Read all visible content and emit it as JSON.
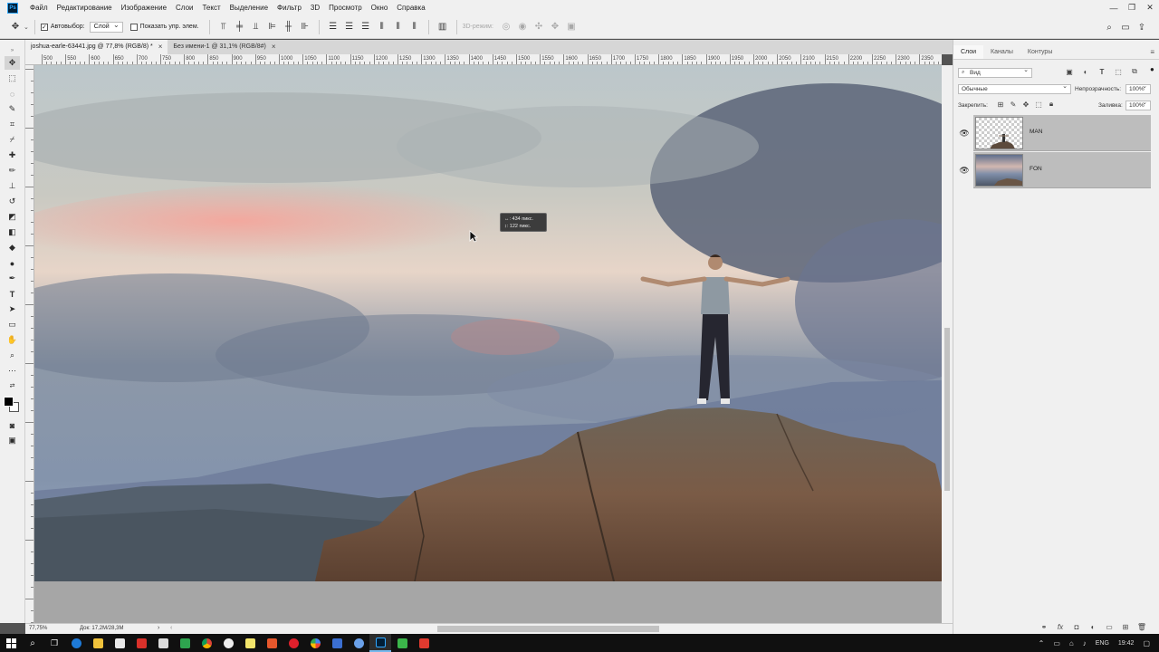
{
  "menu": [
    "Файл",
    "Редактирование",
    "Изображение",
    "Слои",
    "Текст",
    "Выделение",
    "Фильтр",
    "3D",
    "Просмотр",
    "Окно",
    "Справка"
  ],
  "options": {
    "autoselect_label": "Автовыбор:",
    "autoselect_target": "Слой",
    "show_controls_label": "Показать упр. элем.",
    "mode_3d_label": "3D-режим:"
  },
  "tabs": [
    {
      "label": "joshua-earle-63441.jpg @ 77,8% (RGB/8) *"
    },
    {
      "label": "Без имени-1 @ 31,1% (RGB/8#)"
    }
  ],
  "ruler_ticks": [
    "500",
    "550",
    "600",
    "650",
    "700",
    "750",
    "800",
    "850",
    "900",
    "950",
    "1000",
    "1050",
    "1100",
    "1150",
    "1200",
    "1250",
    "1300",
    "1350",
    "1400",
    "1450",
    "1500",
    "1550",
    "1600",
    "1650",
    "1700",
    "1750",
    "1800",
    "1850",
    "1900",
    "1950",
    "2000",
    "2050",
    "2100",
    "2150",
    "2200",
    "2250",
    "2300",
    "2350"
  ],
  "tooltip": {
    "line1": "↔: 434 пикс.",
    "line2": "↕: 122 пикс."
  },
  "status": {
    "zoom": "77,75%",
    "doc": "Док: 17,2M/28,3M"
  },
  "panel": {
    "tabs": [
      "Слои",
      "Каналы",
      "Контуры"
    ],
    "filter_kind": "Вид",
    "blend_mode": "Обычные",
    "opacity_label": "Непрозрачность:",
    "opacity_value": "100%",
    "lock_label": "Закрепить:",
    "fill_label": "Заливка:",
    "fill_value": "100%",
    "layers": [
      {
        "name": "MAN",
        "visible": true
      },
      {
        "name": "FON",
        "visible": true
      }
    ]
  },
  "tray": {
    "lang": "ENG",
    "time": "19:42"
  },
  "colors": {
    "accent": "#31a8ff",
    "panel_bg": "#f0f0f0",
    "canvas_bg": "#a6a6a6"
  }
}
